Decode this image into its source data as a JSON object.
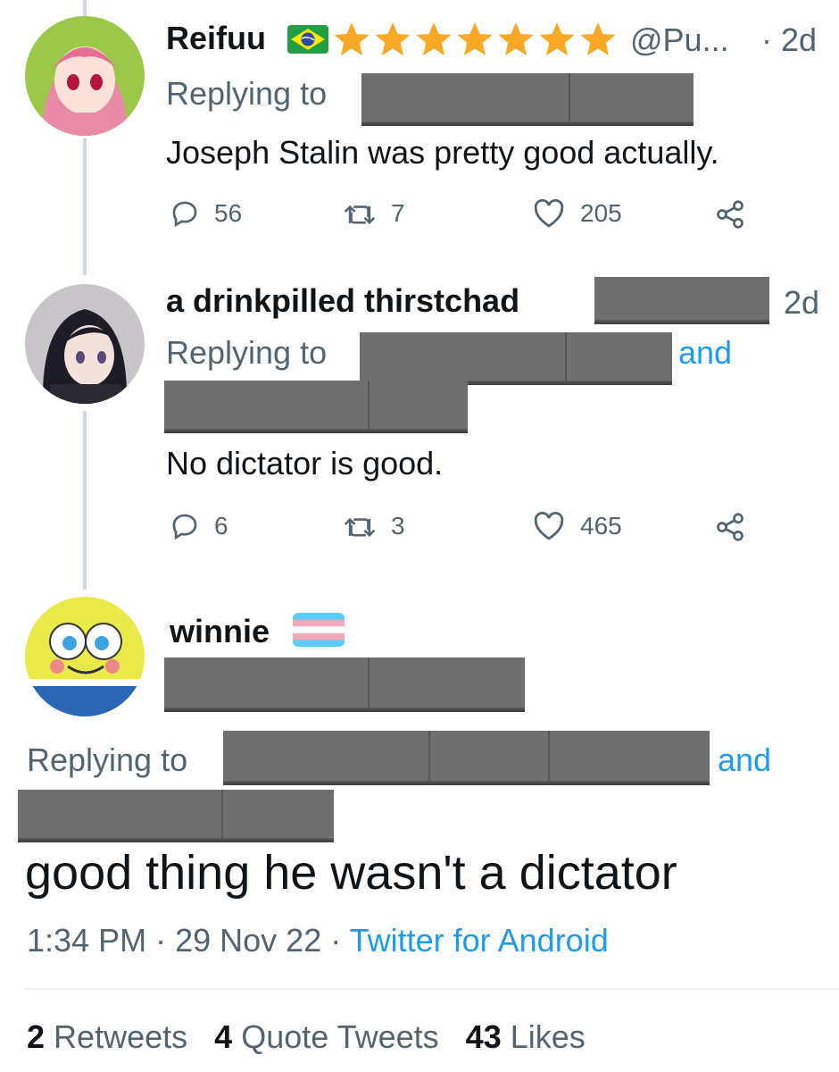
{
  "tweets": [
    {
      "display_name": "Reifuu",
      "handle": "@Pu...",
      "time": "· 2d",
      "replying_label": "Replying to",
      "text": "Joseph Stalin was pretty good actually.",
      "replies": "56",
      "retweets": "7",
      "likes": "205"
    },
    {
      "display_name": "a drinkpilled thirstchad",
      "time": "2d",
      "replying_label": "Replying to",
      "and_label": "and",
      "text": "No dictator is good.",
      "replies": "6",
      "retweets": "3",
      "likes": "465"
    }
  ],
  "main_tweet": {
    "display_name": "winnie",
    "replying_label": "Replying to",
    "and_label": "and",
    "text": "good thing he wasn't a dictator",
    "time": "1:34 PM",
    "date": "29 Nov 22",
    "client": "Twitter for Android",
    "sep": "·",
    "retweets_count": "2",
    "retweets_label": "Retweets",
    "quotes_count": "4",
    "quotes_label": "Quote Tweets",
    "likes_count": "43",
    "likes_label": "Likes"
  },
  "colors": {
    "link": "#1d9bf0",
    "muted": "#536471",
    "redaction": "#6f6f6f",
    "star": "#f9a825"
  },
  "icons": [
    "reply-icon",
    "retweet-icon",
    "like-icon",
    "share-icon",
    "brazil-flag-icon",
    "star-icon",
    "trans-flag-icon"
  ]
}
